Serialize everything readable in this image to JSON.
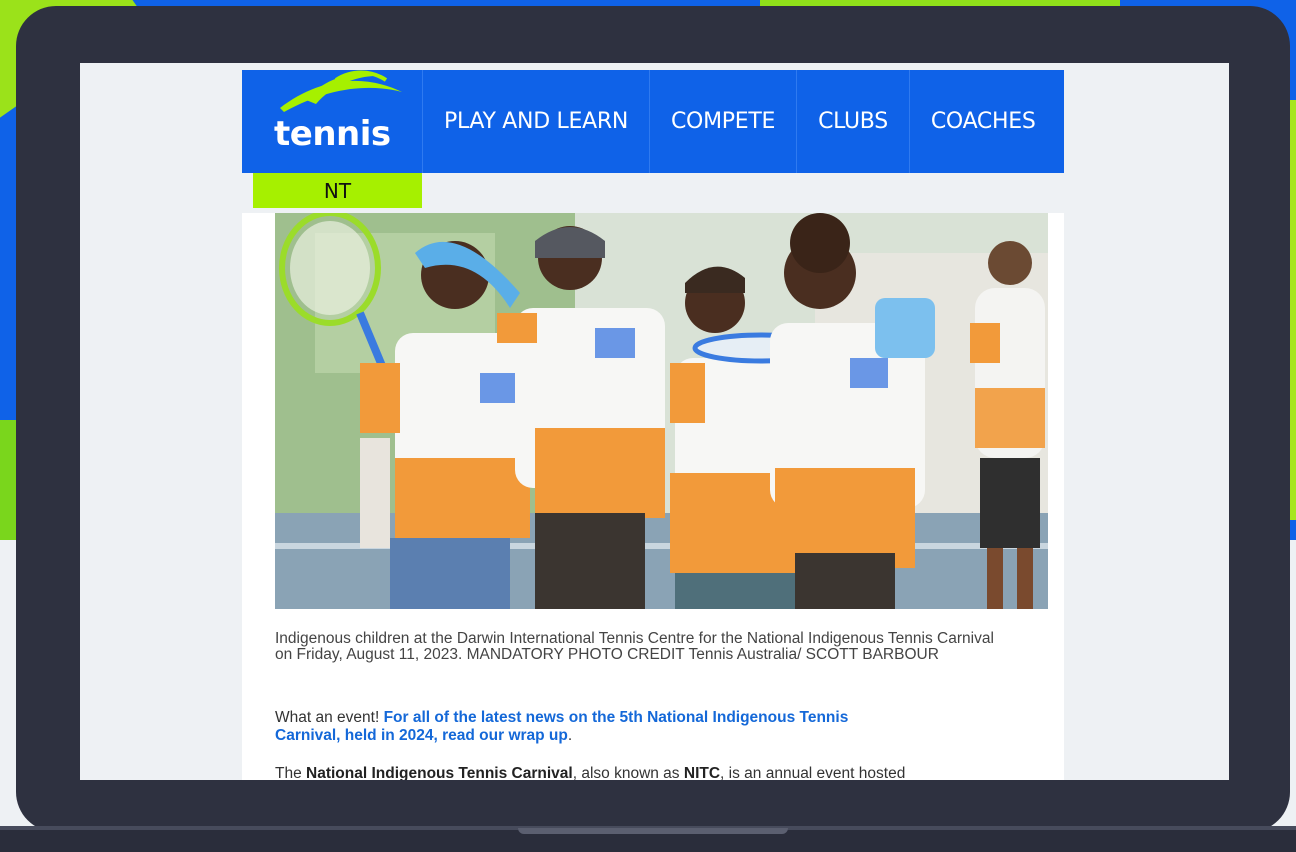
{
  "site": {
    "logo_text": "tennis",
    "region_badge": "NT",
    "nav": [
      {
        "label": "PLAY AND LEARN"
      },
      {
        "label": "COMPETE"
      },
      {
        "label": "CLUBS"
      },
      {
        "label": "COACHES"
      }
    ]
  },
  "article": {
    "photo_alt": "Indigenous children at the Darwin International Tennis Centre for the National Indigenous Tennis Carnival on Friday, August 11, 2023. MANDATORY PHOTO CREDIT Tennis Australia/ SCOTT BARBOUR",
    "caption": "Indigenous children at the Darwin International Tennis Centre for the National Indigenous Tennis Carnival on Friday, August 11, 2023. MANDATORY PHOTO CREDIT Tennis Australia/ SCOTT BARBOUR",
    "intro_plain": "What an event! ",
    "intro_link": "For all of the latest news on the 5th National Indigenous Tennis Carnival, held in 2024, read our wrap up",
    "intro_end": ".",
    "body_start": "The ",
    "body_bold1": "National Indigenous Tennis Carnival",
    "body_mid": ", also known as ",
    "body_bold2": "NITC",
    "body_end": ", is an annual event hosted"
  },
  "colors": {
    "brand_blue": "#0f62e8",
    "brand_green": "#a6f000",
    "link_blue": "#1468d8"
  }
}
